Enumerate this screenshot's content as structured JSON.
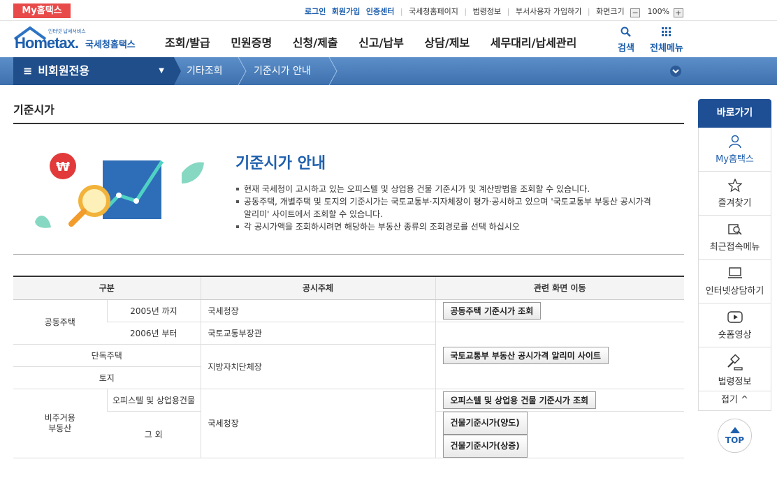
{
  "utility": {
    "my_hometax": "My홈택스",
    "links": [
      "로그인",
      "회원가입",
      "인증센터",
      "국세청홈페이지",
      "법령정보",
      "부서사용자 가입하기",
      "화면크기"
    ],
    "zoom": "100%"
  },
  "logo": {
    "tagline": "인터넷 납세서비스",
    "brand": "Hometax.",
    "kr": "국세청홈택스"
  },
  "gnb": [
    "조회/발급",
    "민원증명",
    "신청/제출",
    "신고/납부",
    "상담/제보",
    "세무대리/납세관리"
  ],
  "header": {
    "search": "검색",
    "all_menu": "전체메뉴"
  },
  "nav": {
    "mode": "비회원전용",
    "crumbs": [
      "기타조회",
      "기준시가 안내"
    ]
  },
  "page": {
    "title": "기준시가",
    "guide_title": "기준시가 안내",
    "bullets": [
      "현재 국세청이 고시하고 있는 오피스텔 및 상업용 건물 기준시가 및 계산방법을 조회할 수 있습니다.",
      "공동주택, 개별주택 및 토지의 기준시가는 국토교통부·지자체장이 평가·공시하고 있으며 '국토교통부 부동산 공시가격 알리미' 사이트에서 조회할 수 있습니다.",
      "각 공시가액을 조회하시려면 해당하는 부동산 종류의 조회경로를 선택 하십시오"
    ]
  },
  "table": {
    "headers": [
      "구분",
      "공시주체",
      "관련 화면 이동"
    ],
    "r1": {
      "a": "공동주택",
      "b": "2005년 까지",
      "c": "국세청장",
      "btn": "공동주택 기준시가 조회"
    },
    "r2": {
      "b": "2006년 부터",
      "c": "국토교통부장관"
    },
    "r3": {
      "a": "단독주택",
      "c": "지방자치단체장",
      "btn": "국토교통부 부동산 공시가격 알리미 사이트"
    },
    "r4": {
      "a": "토지"
    },
    "r5": {
      "a": "비주거용\n부동산",
      "b": "오피스텔 및 상업용건물",
      "c": "국세청장",
      "btn": "오피스텔 및 상업용 건물 기준시가 조회"
    },
    "r6": {
      "b": "그 외",
      "btn1": "건물기준시가(양도)",
      "btn2": "건물기준시가(상증)"
    }
  },
  "quick": {
    "title": "바로가기",
    "items": [
      "My홈택스",
      "즐겨찾기",
      "최근접속메뉴",
      "인터넷상담하기",
      "숏폼영상",
      "법령정보"
    ],
    "fold": "접기 ^",
    "top": "TOP"
  },
  "colors": {
    "brand_blue": "#1e5fae",
    "nav_dark": "#1f4e8b",
    "my_red": "#e84a4a"
  }
}
